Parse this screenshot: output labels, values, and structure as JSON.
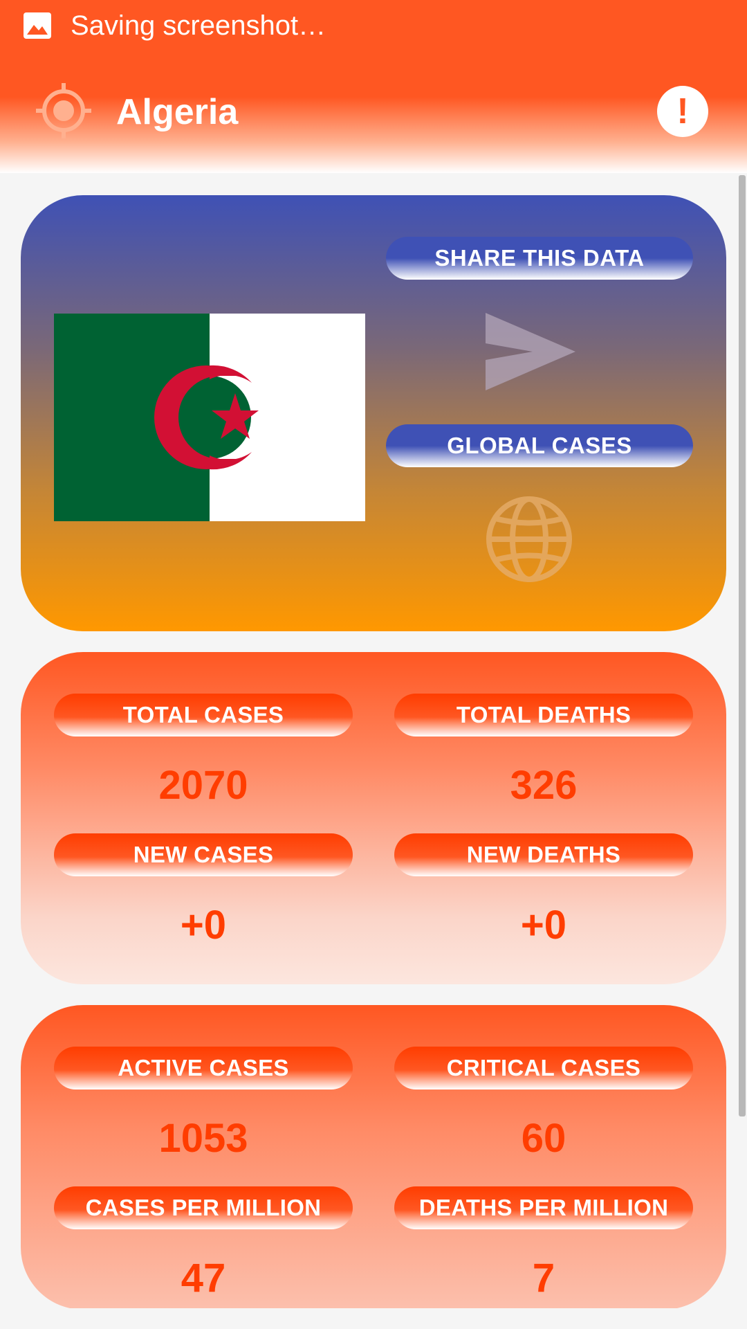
{
  "status_bar": {
    "notification_text": "Saving screenshot…"
  },
  "app_bar": {
    "title": "Algeria",
    "alert_glyph": "!"
  },
  "country_card": {
    "flag": "Algeria",
    "share_label": "SHARE THIS DATA",
    "global_label": "GLOBAL CASES",
    "icons": [
      "send-icon",
      "globe-icon"
    ]
  },
  "stats_primary": {
    "total_cases_label": "TOTAL CASES",
    "total_cases_value": "2070",
    "total_deaths_label": "TOTAL DEATHS",
    "total_deaths_value": "326",
    "new_cases_label": "NEW CASES",
    "new_cases_value": "+0",
    "new_deaths_label": "NEW DEATHS",
    "new_deaths_value": "+0"
  },
  "stats_secondary": {
    "active_cases_label": "ACTIVE CASES",
    "active_cases_value": "1053",
    "critical_cases_label": "CRITICAL CASES",
    "critical_cases_value": "60",
    "cases_per_million_label": "CASES PER MILLION",
    "cases_per_million_value": "47",
    "deaths_per_million_label": "DEATHS PER MILLION",
    "deaths_per_million_value": "7"
  },
  "colors": {
    "primary": "#ff5722",
    "accent_blue": "#3f51b5",
    "accent_orange": "#ff9800",
    "value_text": "#ff3d00"
  }
}
